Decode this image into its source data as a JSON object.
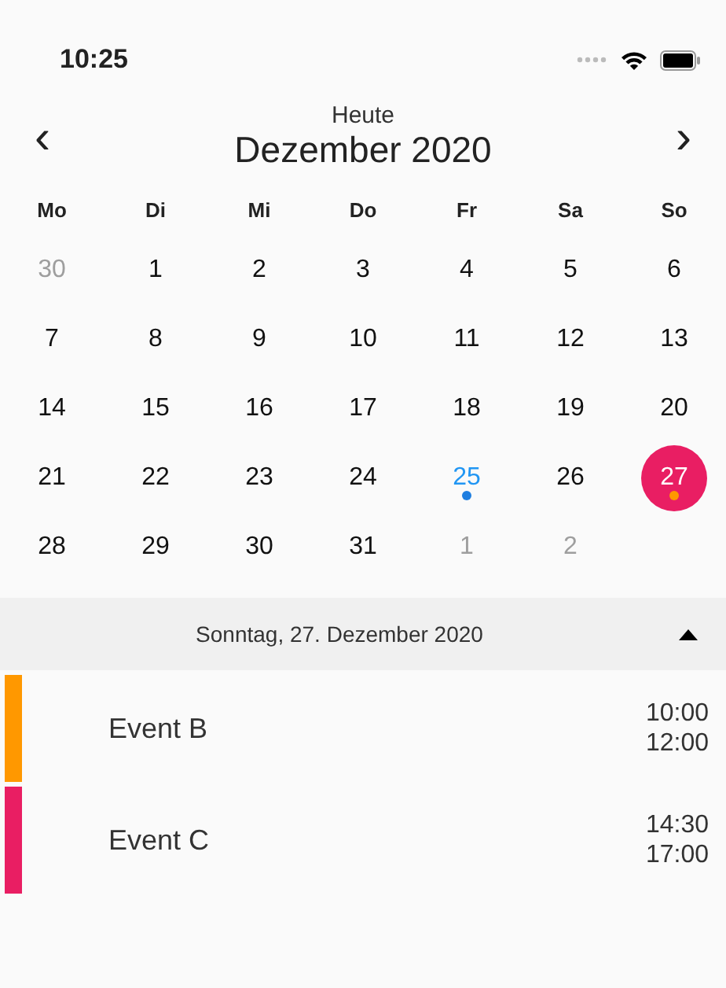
{
  "status_bar": {
    "time": "10:25"
  },
  "header": {
    "today_label": "Heute",
    "month": "Dezember 2020",
    "prev": "‹",
    "next": "›"
  },
  "weekdays": [
    "Mo",
    "Di",
    "Mi",
    "Do",
    "Fr",
    "Sa",
    "So"
  ],
  "days": [
    {
      "label": "30",
      "in_month": false,
      "today": false,
      "selected": false
    },
    {
      "label": "1",
      "in_month": true,
      "today": false,
      "selected": false
    },
    {
      "label": "2",
      "in_month": true,
      "today": false,
      "selected": false
    },
    {
      "label": "3",
      "in_month": true,
      "today": false,
      "selected": false
    },
    {
      "label": "4",
      "in_month": true,
      "today": false,
      "selected": false
    },
    {
      "label": "5",
      "in_month": true,
      "today": false,
      "selected": false
    },
    {
      "label": "6",
      "in_month": true,
      "today": false,
      "selected": false
    },
    {
      "label": "7",
      "in_month": true,
      "today": false,
      "selected": false
    },
    {
      "label": "8",
      "in_month": true,
      "today": false,
      "selected": false
    },
    {
      "label": "9",
      "in_month": true,
      "today": false,
      "selected": false
    },
    {
      "label": "10",
      "in_month": true,
      "today": false,
      "selected": false
    },
    {
      "label": "11",
      "in_month": true,
      "today": false,
      "selected": false
    },
    {
      "label": "12",
      "in_month": true,
      "today": false,
      "selected": false
    },
    {
      "label": "13",
      "in_month": true,
      "today": false,
      "selected": false
    },
    {
      "label": "14",
      "in_month": true,
      "today": false,
      "selected": false
    },
    {
      "label": "15",
      "in_month": true,
      "today": false,
      "selected": false
    },
    {
      "label": "16",
      "in_month": true,
      "today": false,
      "selected": false
    },
    {
      "label": "17",
      "in_month": true,
      "today": false,
      "selected": false
    },
    {
      "label": "18",
      "in_month": true,
      "today": false,
      "selected": false
    },
    {
      "label": "19",
      "in_month": true,
      "today": false,
      "selected": false
    },
    {
      "label": "20",
      "in_month": true,
      "today": false,
      "selected": false
    },
    {
      "label": "21",
      "in_month": true,
      "today": false,
      "selected": false
    },
    {
      "label": "22",
      "in_month": true,
      "today": false,
      "selected": false
    },
    {
      "label": "23",
      "in_month": true,
      "today": false,
      "selected": false
    },
    {
      "label": "24",
      "in_month": true,
      "today": false,
      "selected": false
    },
    {
      "label": "25",
      "in_month": true,
      "today": true,
      "selected": false,
      "color": "#1e7ee0"
    },
    {
      "label": "26",
      "in_month": true,
      "today": false,
      "selected": false
    },
    {
      "label": "27",
      "in_month": true,
      "today": false,
      "selected": true,
      "color": "#ff9800"
    },
    {
      "label": "28",
      "in_month": true,
      "today": false,
      "selected": false
    },
    {
      "label": "29",
      "in_month": true,
      "today": false,
      "selected": false
    },
    {
      "label": "30",
      "in_month": true,
      "today": false,
      "selected": false
    },
    {
      "label": "31",
      "in_month": true,
      "today": false,
      "selected": false
    },
    {
      "label": "1",
      "in_month": false,
      "today": false,
      "selected": false
    },
    {
      "label": "2",
      "in_month": false,
      "today": false,
      "selected": false
    }
  ],
  "day_header": {
    "title": "Sonntag, 27. Dezember 2020",
    "expanded": true
  },
  "events": [
    {
      "title": "Event B",
      "start": "10:00",
      "end": "12:00",
      "color": "#ff9800"
    },
    {
      "title": "Event C",
      "start": "14:30",
      "end": "17:00",
      "color": "#e91e63"
    }
  ]
}
